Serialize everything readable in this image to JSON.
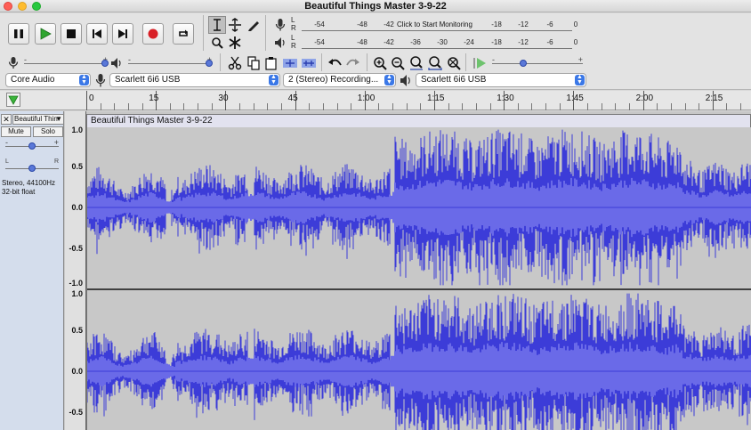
{
  "window": {
    "title": "Beautiful Things Master 3-9-22"
  },
  "transport": {
    "pause_icon": "pause-icon",
    "play_icon": "play-icon",
    "stop_icon": "stop-icon",
    "skip_start_icon": "skip-to-start-icon",
    "skip_end_icon": "skip-to-end-icon",
    "record_icon": "record-icon",
    "loop_icon": "loop-icon"
  },
  "meters": {
    "record_ticks": [
      "-54",
      "-48",
      "-42",
      "-18",
      "-12",
      "-6",
      "0"
    ],
    "monitor_text": "Click to Start Monitoring",
    "playback_ticks": [
      "-54",
      "-48",
      "-42",
      "-36",
      "-30",
      "-24",
      "-18",
      "-12",
      "-6",
      "0"
    ],
    "channel_l": "L",
    "channel_r": "R"
  },
  "sliders": {
    "minus": "-",
    "plus": "+"
  },
  "devices": {
    "host": "Core Audio",
    "recording_device": "Scarlett 6i6 USB",
    "channels": "2 (Stereo) Recording...",
    "playback_device": "Scarlett 6i6 USB"
  },
  "timeline": {
    "labels": [
      "0",
      "15",
      "30",
      "45",
      "1:00",
      "1:15",
      "1:30",
      "1:45",
      "2:00",
      "2:15"
    ]
  },
  "track": {
    "close": "✕",
    "name": "Beautiful Thin",
    "mute": "Mute",
    "solo": "Solo",
    "gain_minus": "-",
    "gain_plus": "+",
    "pan_l": "L",
    "pan_r": "R",
    "format": "Stereo, 44100Hz",
    "bitdepth": "32-bit float",
    "clip_name": "Beautiful Things Master 3-9-22",
    "scale_top": [
      "1.0",
      "0.5",
      "0.0",
      "-0.5",
      "-1.0"
    ],
    "scale_bottom": [
      "1.0",
      "0.5",
      "0.0",
      "-0.5"
    ],
    "wave_color": "#3c3cd8"
  }
}
